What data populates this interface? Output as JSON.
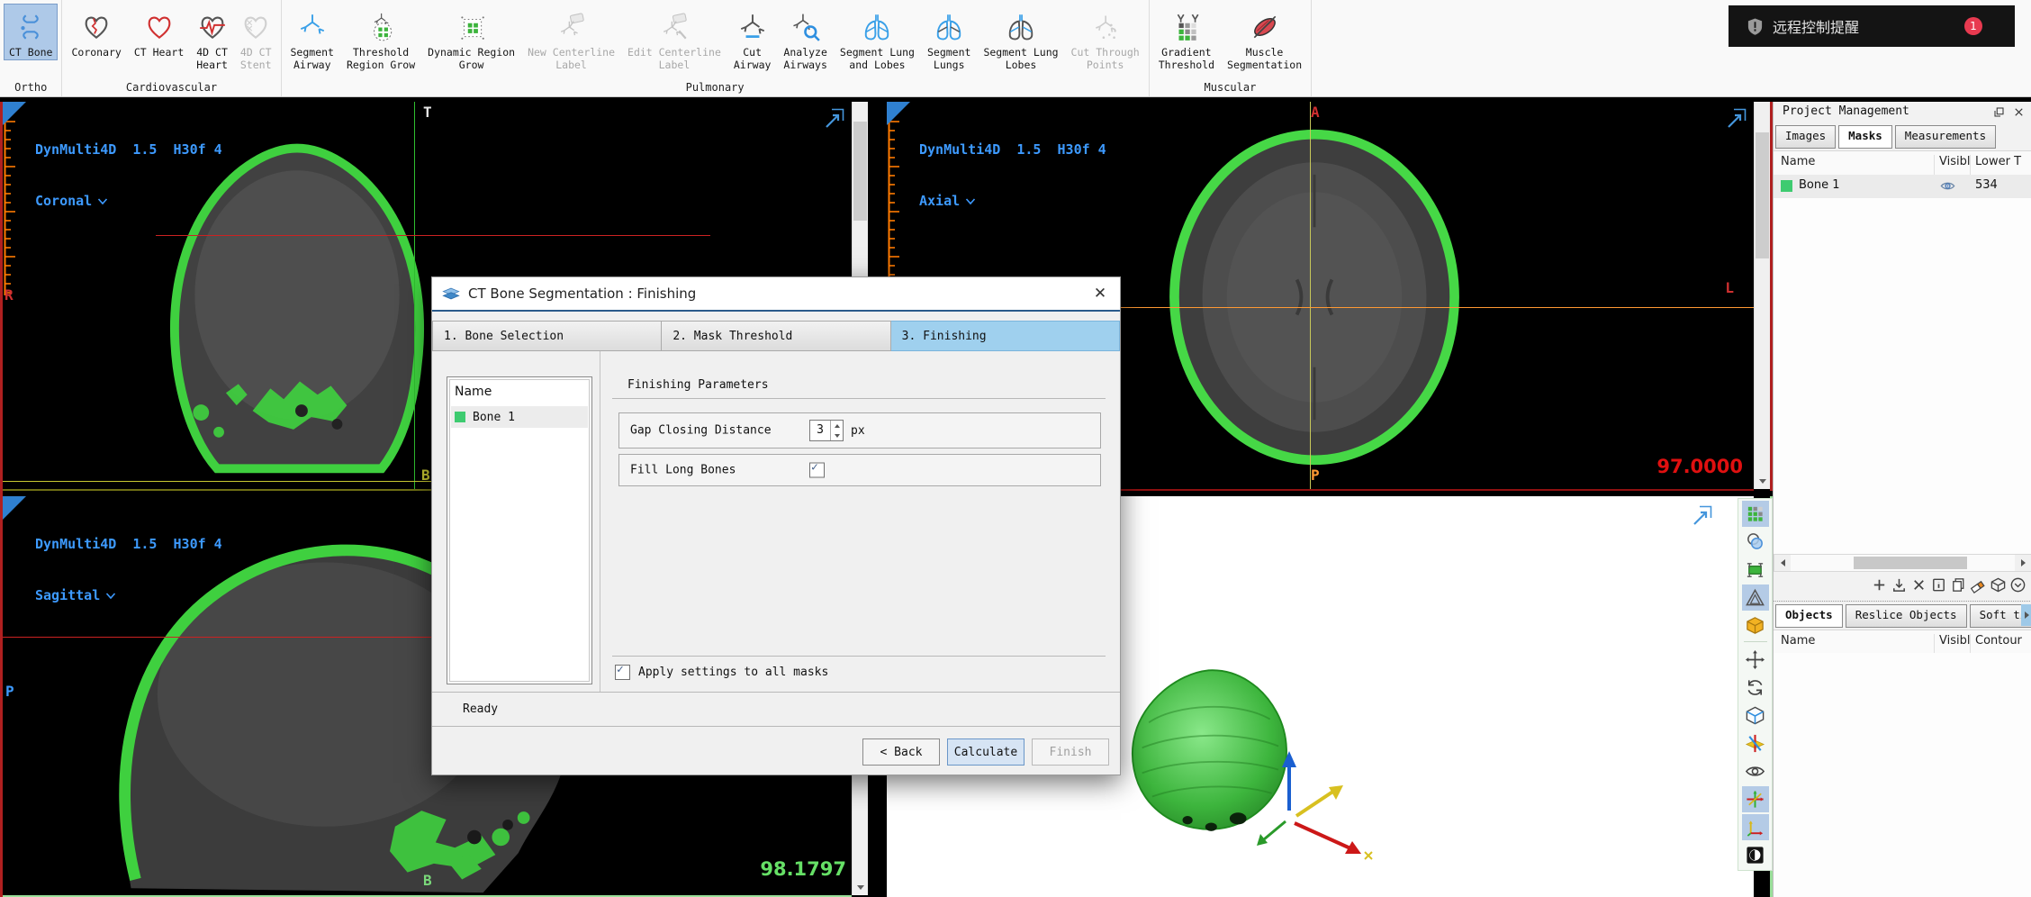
{
  "notification": {
    "text": "远程控制提醒",
    "badge": "1"
  },
  "toolbar": {
    "groups": [
      {
        "label": "Ortho",
        "items": [
          {
            "id": "ct-bone",
            "label": "CT Bone",
            "icon": "ct-bone",
            "selected": true
          }
        ]
      },
      {
        "label": "Cardiovascular",
        "items": [
          {
            "id": "coronary",
            "label": "Coronary",
            "icon": "coronary"
          },
          {
            "id": "ct-heart",
            "label": "CT Heart",
            "icon": "ct-heart"
          },
          {
            "id": "4d-ct-heart",
            "label": "4D CT\nHeart",
            "icon": "heart-4d"
          },
          {
            "id": "4d-ct-stent",
            "label": "4D CT\nStent",
            "icon": "stent-4d",
            "disabled": true
          }
        ]
      },
      {
        "label": "Pulmonary",
        "items": [
          {
            "id": "segment-airway",
            "label": "Segment\nAirway",
            "icon": "airway-blue"
          },
          {
            "id": "threshold-region-grow",
            "label": "Threshold\nRegion Grow",
            "icon": "threshold-grow"
          },
          {
            "id": "dynamic-region-grow",
            "label": "Dynamic Region\nGrow",
            "icon": "dynamic-grow"
          },
          {
            "id": "new-centerline-label",
            "label": "New Centerline\nLabel",
            "icon": "centerline-new",
            "disabled": true
          },
          {
            "id": "edit-centerline-label",
            "label": "Edit Centerline\nLabel",
            "icon": "centerline-edit",
            "disabled": true
          },
          {
            "id": "cut-airway",
            "label": "Cut\nAirway",
            "icon": "airway-cut"
          },
          {
            "id": "analyze-airways",
            "label": "Analyze\nAirways",
            "icon": "airway-analyze"
          },
          {
            "id": "segment-lung-and-lobes",
            "label": "Segment Lung\nand Lobes",
            "icon": "lung-lobes-blue"
          },
          {
            "id": "segment-lungs",
            "label": "Segment\nLungs",
            "icon": "lungs-blue"
          },
          {
            "id": "segment-lung-lobes",
            "label": "Segment Lung\nLobes",
            "icon": "lung-lobes-dark"
          },
          {
            "id": "cut-through-points",
            "label": "Cut Through\nPoints",
            "icon": "cut-points",
            "disabled": true
          }
        ]
      },
      {
        "label": "Muscular",
        "items": [
          {
            "id": "gradient-threshold",
            "label": "Gradient\nThreshold",
            "icon": "gradient-threshold"
          },
          {
            "id": "muscle-segmentation",
            "label": "Muscle\nSegmentation",
            "icon": "muscle"
          }
        ]
      }
    ]
  },
  "viewports": {
    "coronal": {
      "series": "DynMulti4D  1.5  H30f 4",
      "plane": "Coronal",
      "marker_top": "T",
      "marker_left": "R",
      "marker_bottom": "B"
    },
    "axial": {
      "series": "DynMulti4D  1.5  H30f 4",
      "plane": "Axial",
      "marker_top": "A",
      "marker_right": "L",
      "marker_bottom": "P",
      "slice_value": "97.0000"
    },
    "sagittal": {
      "series": "DynMulti4D  1.5  H30f 4",
      "plane": "Sagittal",
      "marker_left": "P",
      "marker_bottom": "B",
      "slice_value": "98.1797"
    }
  },
  "side_tools": [
    {
      "id": "threshold-grid",
      "selected": true
    },
    {
      "id": "overlap-circles"
    },
    {
      "id": "window-clamp"
    },
    {
      "id": "measure-triangle",
      "selected": true
    },
    {
      "id": "cube-orange",
      "divider_after": true
    },
    {
      "id": "pan-arrows"
    },
    {
      "id": "rotate-3d"
    },
    {
      "id": "cube-3d"
    },
    {
      "id": "reslice-planes"
    },
    {
      "id": "eye-visibility"
    },
    {
      "id": "crosshair-axes",
      "selected": true
    },
    {
      "id": "axis-arrows",
      "selected": true
    },
    {
      "id": "invert-contrast"
    }
  ],
  "project_panel": {
    "title": "Project Management",
    "tabs": [
      {
        "label": "Images"
      },
      {
        "label": "Masks",
        "active": true
      },
      {
        "label": "Measurements"
      }
    ],
    "mask_table": {
      "headers": [
        "Name",
        "Visibl",
        "Lower T"
      ],
      "rows": [
        {
          "name": "Bone 1",
          "swatch": "#3ecb70",
          "visible": true,
          "lower_threshold": "534"
        }
      ]
    },
    "list_tools": [
      "add",
      "import",
      "delete",
      "info",
      "copy",
      "erase",
      "cube",
      "collapse"
    ],
    "object_tabs": [
      {
        "label": "Objects",
        "active": true
      },
      {
        "label": "Reslice Objects"
      },
      {
        "label": "Soft tissue"
      }
    ],
    "object_table": {
      "headers": [
        "Name",
        "Visibl",
        "Contour"
      ],
      "rows": []
    }
  },
  "dialog": {
    "title": "CT Bone Segmentation : Finishing",
    "tabs": [
      {
        "label": "1. Bone Selection"
      },
      {
        "label": "2. Mask Threshold"
      },
      {
        "label": "3. Finishing",
        "active": true
      }
    ],
    "mask_list": {
      "header": "Name",
      "items": [
        {
          "name": "Bone 1",
          "swatch": "#3ecb70",
          "selected": true
        }
      ]
    },
    "params": {
      "group_title": "Finishing Parameters",
      "rows": [
        {
          "label": "Gap Closing Distance",
          "control": "spin",
          "value": "3",
          "unit": "px"
        },
        {
          "label": "Fill Long Bones",
          "control": "check",
          "checked": true
        }
      ]
    },
    "apply_all": {
      "label": "Apply settings to all masks",
      "checked": true
    },
    "status": "Ready",
    "buttons": [
      {
        "id": "back",
        "label": "< Back"
      },
      {
        "id": "calculate",
        "label": "Calculate",
        "accent": true
      },
      {
        "id": "finish",
        "label": "Finish",
        "disabled": true
      }
    ]
  },
  "colors": {
    "accent_blue": "#3d9aff",
    "mask_green": "#3ecb70",
    "skull_green": "#3fd03f",
    "selection_blue": "#aec9e8",
    "dialog_tab_active": "#9fd0ee",
    "crosshair_red": "#cc2222",
    "crosshair_green": "#2fbf2f",
    "crosshair_orange": "#ff9933",
    "crosshair_yellow": "#c8c832",
    "axial_value_red": "#e01010",
    "sagittal_value_green": "#66e066",
    "badge_red": "#e83a50"
  }
}
